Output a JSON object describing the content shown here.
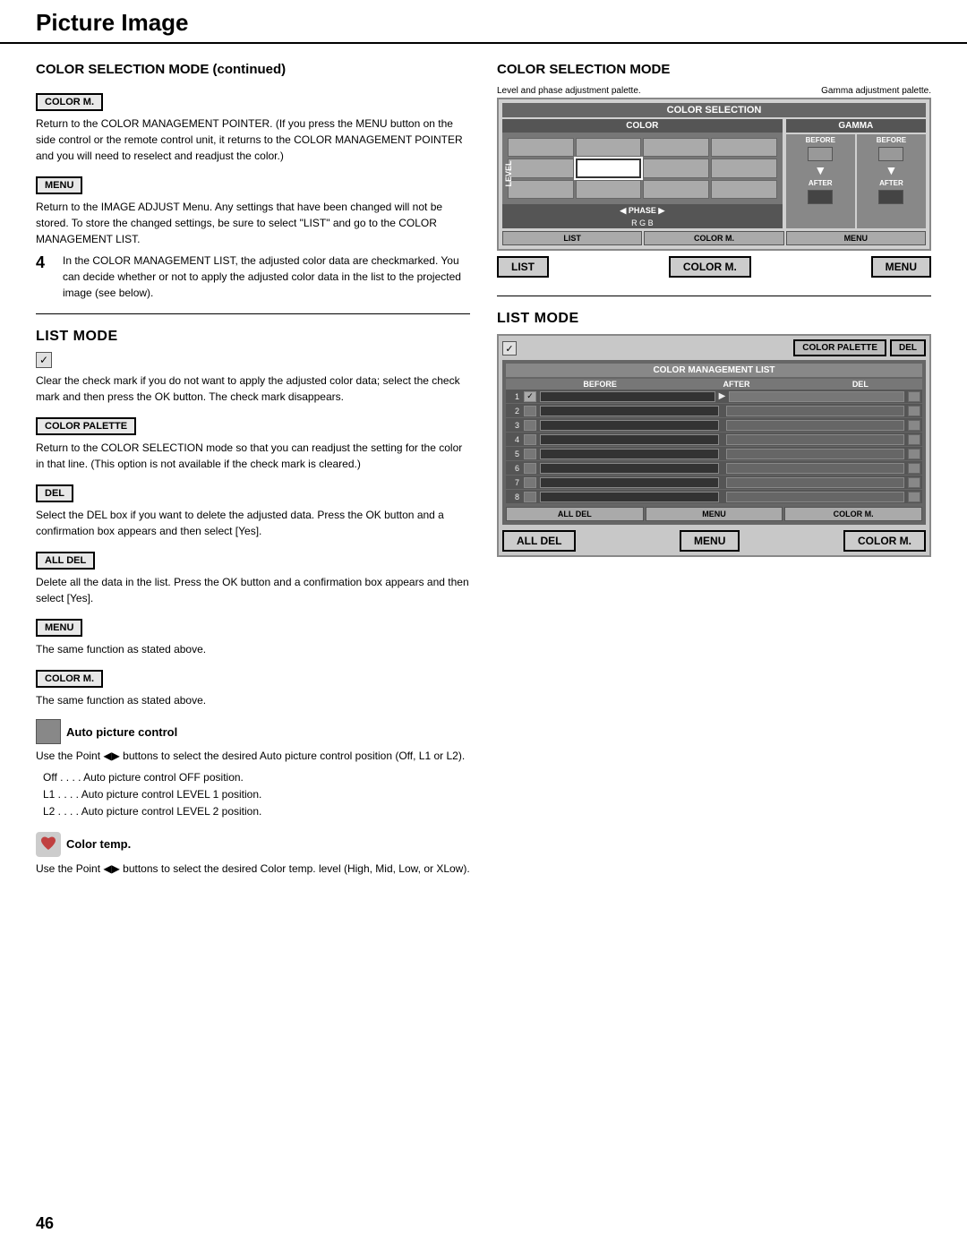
{
  "header": {
    "title": "Picture Image"
  },
  "left": {
    "section_title": "COLOR SELECTION MODE (continued)",
    "color_m_label": "COLOR M.",
    "color_m_text": "Return to the COLOR MANAGEMENT POINTER. (If you press the MENU button on the side control or the remote control unit, it returns to the COLOR MANAGEMENT POINTER and you will need to reselect and readjust the color.)",
    "menu_label": "MENU",
    "menu_text": "Return to the IMAGE ADJUST Menu. Any settings that have been changed will not be stored. To store the changed settings, be sure to select \"LIST\" and go to the COLOR MANAGEMENT LIST.",
    "numbered_4_text": "In the COLOR MANAGEMENT LIST, the adjusted color data are checkmarked. You can decide whether or not to apply the adjusted color data in the list to the projected image (see below).",
    "list_mode_title": "LIST MODE",
    "check_symbol": "✓",
    "list_mode_text": "Clear the check mark if you do not want to apply the adjusted color data; select the check mark and then press the OK button. The check mark disappears.",
    "color_palette_label": "COLOR PALETTE",
    "color_palette_text": "Return to the COLOR SELECTION mode so that you can readjust the setting for the color in that line. (This option is not available if the check mark is cleared.)",
    "del_label": "DEL",
    "del_text": "Select the DEL box if you want to delete the adjusted data. Press the OK button and a confirmation box appears and then select [Yes].",
    "all_del_label": "ALL DEL",
    "all_del_text": "Delete all the data in the list. Press the OK button and a confirmation box appears and then select [Yes].",
    "menu2_label": "MENU",
    "menu2_text": "The same function as stated above.",
    "color_m2_label": "COLOR M.",
    "color_m2_text": "The same function as stated above.",
    "auto_picture_label": "Auto picture control",
    "auto_picture_text": "Use the Point ◀▶ buttons to select the desired Auto picture control position (Off, L1 or L2).",
    "auto_off": "Off . . . .  Auto picture control OFF position.",
    "auto_l1": "L1 . . . .  Auto picture control LEVEL 1 position.",
    "auto_l2": "L2 . . . .  Auto picture control LEVEL 2 position.",
    "color_temp_label": "Color temp.",
    "color_temp_text": "Use the Point ◀▶ buttons to select the desired Color temp. level (High, Mid, Low, or XLow)."
  },
  "right": {
    "section_title": "COLOR SELECTION MODE",
    "label_left": "Level and phase adjustment palette.",
    "label_right": "Gamma adjustment palette.",
    "color_selection_inner": "COLOR SELECTION",
    "color_label": "COLOR",
    "gamma_label": "GAMMA",
    "before_label": "BEFORE",
    "after_label": "AFTER",
    "level_label": "LEVEL",
    "phase_label": "◀ PHASE ▶",
    "rgb_label": "R  G B",
    "btn_list": "LIST",
    "btn_color_m": "COLOR M.",
    "btn_menu": "MENU",
    "big_list": "LIST",
    "big_color_m": "COLOR M.",
    "big_menu": "MENU",
    "list_mode_title": "LIST MODE",
    "color_palette_btn": "COLOR PALETTE",
    "del_btn": "DEL",
    "color_mgmt_title": "COLOR MANAGEMENT LIST",
    "col_before": "BEFORE",
    "col_after": "AFTER",
    "col_del": "DEL",
    "rows": [
      {
        "num": "1",
        "checked": true,
        "has_arrow": true
      },
      {
        "num": "2",
        "checked": false,
        "has_arrow": false
      },
      {
        "num": "3",
        "checked": false,
        "has_arrow": false
      },
      {
        "num": "4",
        "checked": false,
        "has_arrow": false
      },
      {
        "num": "5",
        "checked": false,
        "has_arrow": false
      },
      {
        "num": "6",
        "checked": false,
        "has_arrow": false
      },
      {
        "num": "7",
        "checked": false,
        "has_arrow": false
      },
      {
        "num": "8",
        "checked": false,
        "has_arrow": false
      }
    ],
    "list_btn_all_del": "ALL DEL",
    "list_btn_menu": "MENU",
    "list_btn_color_m": "COLOR M.",
    "big_all_del": "ALL DEL",
    "big_menu2": "MENU",
    "big_color_m2": "COLOR M."
  },
  "footer": {
    "page_number": "46"
  }
}
